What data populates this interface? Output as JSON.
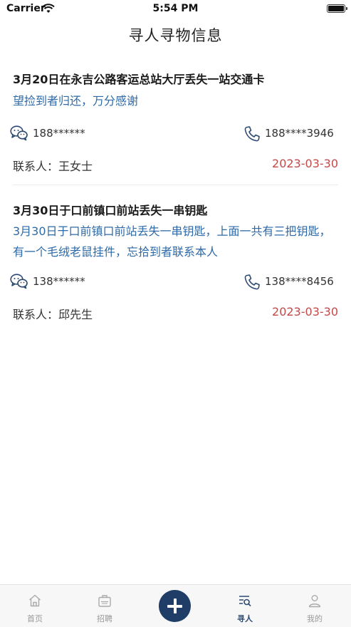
{
  "status_bar": {
    "carrier": "Carrier",
    "time": "5:54 PM"
  },
  "header": {
    "title": "寻人寻物信息"
  },
  "posts": [
    {
      "title": "3月20日在永吉公路客运总站大厅丢失一站交通卡",
      "description": "望捡到者归还，万分感谢",
      "wechat": "188******",
      "phone": "188****3946",
      "contact": "联系人：王女士",
      "date": "2023-03-30"
    },
    {
      "title": "3月30日于口前镇口前站丢失一串钥匙",
      "description": "3月30日于口前镇口前站丢失一串钥匙，上面一共有三把钥匙，有一个毛绒老鼠挂件，忘拾到者联系本人",
      "wechat": "138******",
      "phone": "138****8456",
      "contact": "联系人：邱先生",
      "date": "2023-03-30"
    }
  ],
  "tabbar": {
    "tabs": [
      {
        "label": "首页",
        "icon": "home-icon"
      },
      {
        "label": "招聘",
        "icon": "job-icon"
      },
      {
        "label": "寻人",
        "icon": "search-list-icon",
        "active": true
      },
      {
        "label": "我的",
        "icon": "user-icon"
      }
    ],
    "add_icon": "plus-icon"
  },
  "colors": {
    "accent": "#1f3d66",
    "link_text": "#2e6aa8",
    "date": "#c24a4a"
  }
}
